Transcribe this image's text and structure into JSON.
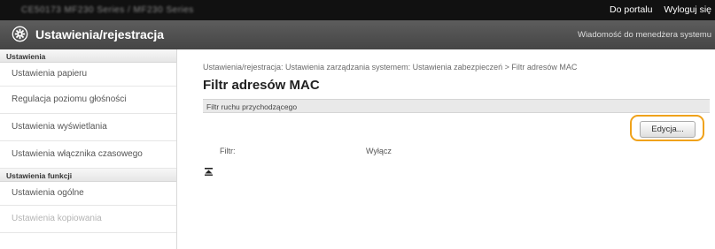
{
  "topbar": {
    "device_name": "CE50173 MF230 Series / MF230 Series",
    "portal_link": "Do portalu",
    "logout_link": "Wyloguj się"
  },
  "header": {
    "title": "Ustawienia/rejestracja",
    "admin_message": "Wiadomość do menedżera systemu"
  },
  "sidebar": {
    "groups": [
      {
        "label": "Ustawienia",
        "items": [
          {
            "label": "Ustawienia papieru"
          },
          {
            "label": "Regulacja poziomu głośności"
          },
          {
            "label": "Ustawienia wyświetlania"
          },
          {
            "label": "Ustawienia włącznika czasowego"
          }
        ]
      },
      {
        "label": "Ustawienia funkcji",
        "items": [
          {
            "label": "Ustawienia ogólne"
          },
          {
            "label": "Ustawienia kopiowania",
            "disabled": true
          }
        ]
      }
    ]
  },
  "main": {
    "breadcrumb": "Ustawienia/rejestracja: Ustawienia zarządzania systemem: Ustawienia zabezpieczeń > Filtr adresów MAC",
    "title": "Filtr adresów MAC",
    "section_title": "Filtr ruchu przychodzącego",
    "edit_button": "Edycja...",
    "filter_label": "Filtr:",
    "filter_value": "Wyłącz"
  },
  "icons": {
    "header_icon": "gear-icon",
    "back_to_top": "to-top-icon"
  },
  "colors": {
    "highlight": "#f0a21a",
    "header_bg": "#4e4e4e",
    "topbar_bg": "#111111"
  }
}
